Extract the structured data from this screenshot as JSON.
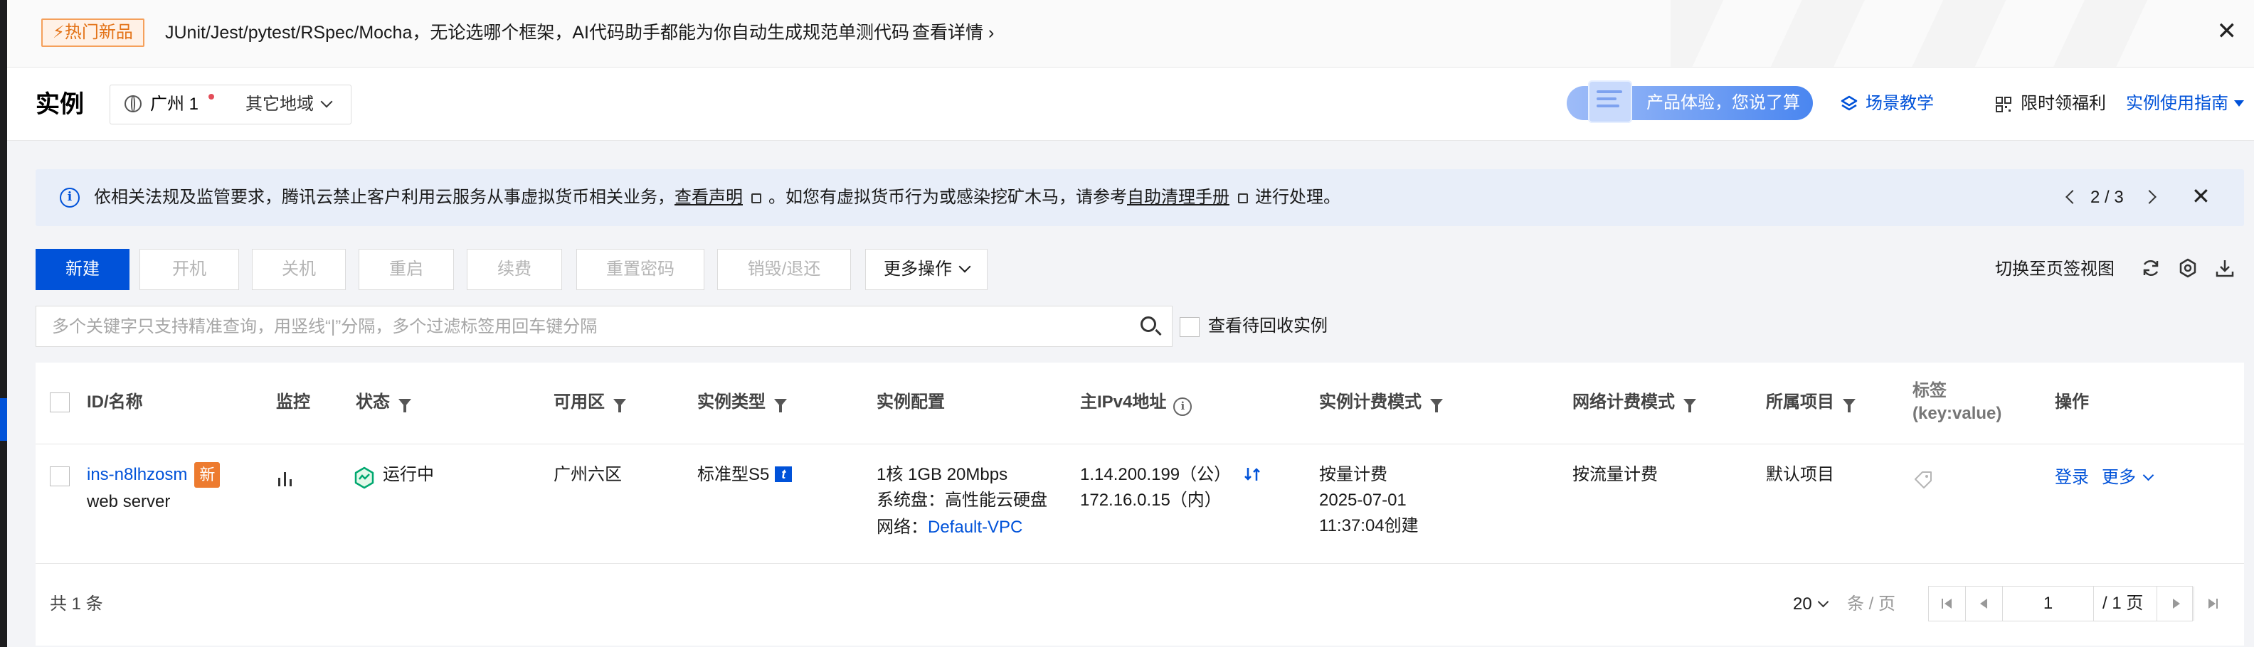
{
  "promo": {
    "badge": "⚡热门新品",
    "text": "JUnit/Jest/pytest/RSpec/Mocha，无论选哪个框架，AI代码助手都能为你自动生成规范单测代码",
    "link": "查看详情 ›",
    "close": "✕"
  },
  "header": {
    "title": "实例",
    "region": "广州 1",
    "other_region": "其它地域",
    "feedback": "产品体验，您说了算",
    "scene_teaching": "场景教学",
    "limited_benefit": "限时领福利",
    "usage_guide": "实例使用指南"
  },
  "notice": {
    "part1": "依相关法规及监管要求，腾讯云禁止客户利用云服务从事虚拟货币相关业务，",
    "link1": "查看声明",
    "part2": "。如您有虚拟货币行为或感染挖矿木马，请参考",
    "link2": "自助清理手册",
    "part3": "进行处理。",
    "page": "2 / 3",
    "close": "✕"
  },
  "toolbar": {
    "new": "新建",
    "start": "开机",
    "shutdown": "关机",
    "restart": "重启",
    "renew": "续费",
    "reset_password": "重置密码",
    "destroy": "销毁/退还",
    "more": "更多操作",
    "switch_view": "切换至页签视图"
  },
  "search": {
    "placeholder": "多个关键字只支持精准查询，用竖线“|”分隔，多个过滤标签用回车键分隔",
    "recycle_label": "查看待回收实例"
  },
  "table": {
    "headers": {
      "id_name": "ID/名称",
      "monitor": "监控",
      "status": "状态",
      "zone": "可用区",
      "instance_type": "实例类型",
      "config": "实例配置",
      "ipv4": "主IPv4地址",
      "billing": "实例计费模式",
      "net_billing": "网络计费模式",
      "project": "所属项目",
      "tag_line1": "标签",
      "tag_line2": "(key:value)",
      "ops": "操作"
    },
    "rows": [
      {
        "id": "ins-n8lhzosm",
        "new_badge": "新",
        "name": "web server",
        "status": "运行中",
        "zone": "广州六区",
        "type": "标准型S5",
        "type_badge": "t",
        "config_line1": "1核 1GB 20Mbps",
        "config_line2": "系统盘：高性能云硬盘",
        "network_label": "网络：",
        "network_link": "Default-VPC",
        "public_ip": "1.14.200.199（公）",
        "private_ip": "172.16.0.15（内）",
        "billing": "按量计费",
        "created_date": "2025-07-01",
        "created_time": "11:37:04创建",
        "net_billing": "按流量计费",
        "project": "默认项目",
        "op_login": "登录",
        "op_more": "更多"
      }
    ],
    "total": "共 1 条",
    "page_size": "20",
    "per_page": "条 / 页",
    "current_page": "1",
    "total_pages": "/ 1 页"
  },
  "colors": {
    "brand": "#0052d9",
    "running": "#00a870",
    "new_badge": "#ed7b2f"
  }
}
